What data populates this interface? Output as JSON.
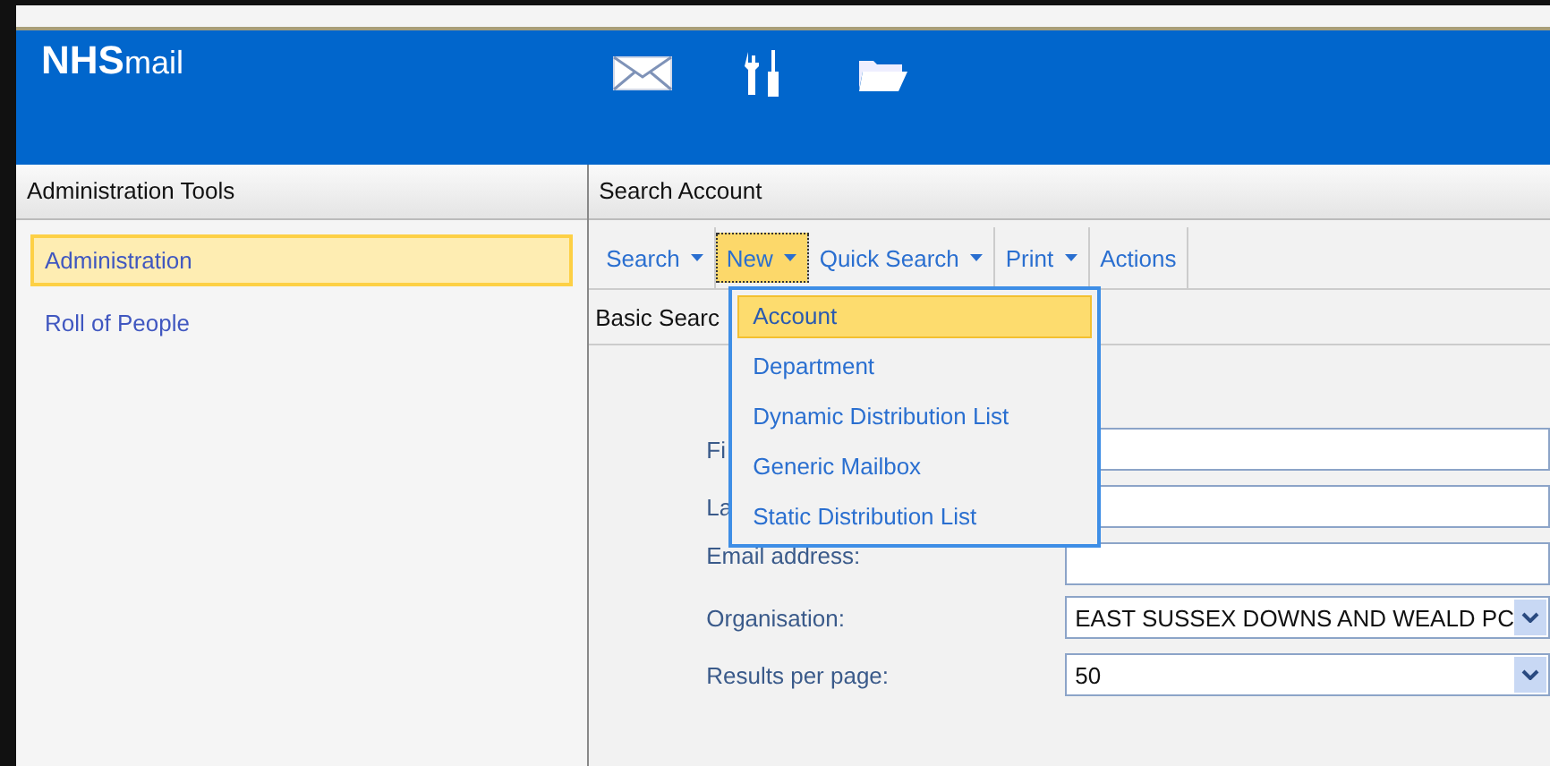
{
  "header": {
    "logo_bold": "NHS",
    "logo_light": "mail"
  },
  "sidebar": {
    "title": "Administration Tools",
    "items": [
      {
        "label": "Administration",
        "selected": true
      },
      {
        "label": "Roll of People",
        "selected": false
      }
    ]
  },
  "main": {
    "title": "Search Account",
    "toolbar": [
      {
        "label": "Search",
        "dropdown": true,
        "selected": false
      },
      {
        "label": "New",
        "dropdown": true,
        "selected": true
      },
      {
        "label": "Quick Search",
        "dropdown": true,
        "selected": false
      },
      {
        "label": "Print",
        "dropdown": true,
        "selected": false
      },
      {
        "label": "Actions",
        "dropdown": false,
        "selected": false
      }
    ],
    "tab": "Basic Searc",
    "menu": [
      {
        "label": "Account",
        "selected": true
      },
      {
        "label": "Department",
        "selected": false
      },
      {
        "label": "Dynamic Distribution List",
        "selected": false
      },
      {
        "label": "Generic Mailbox",
        "selected": false
      },
      {
        "label": "Static Distribution List",
        "selected": false
      }
    ],
    "form": [
      {
        "label": "Fi",
        "kind": "text"
      },
      {
        "label": "La",
        "kind": "text"
      },
      {
        "label": "Email address:",
        "kind": "text"
      },
      {
        "label": "Organisation:",
        "kind": "select",
        "value": "EAST SUSSEX DOWNS AND WEALD PC"
      },
      {
        "label": "Results per page:",
        "kind": "select",
        "value": "50"
      }
    ]
  }
}
